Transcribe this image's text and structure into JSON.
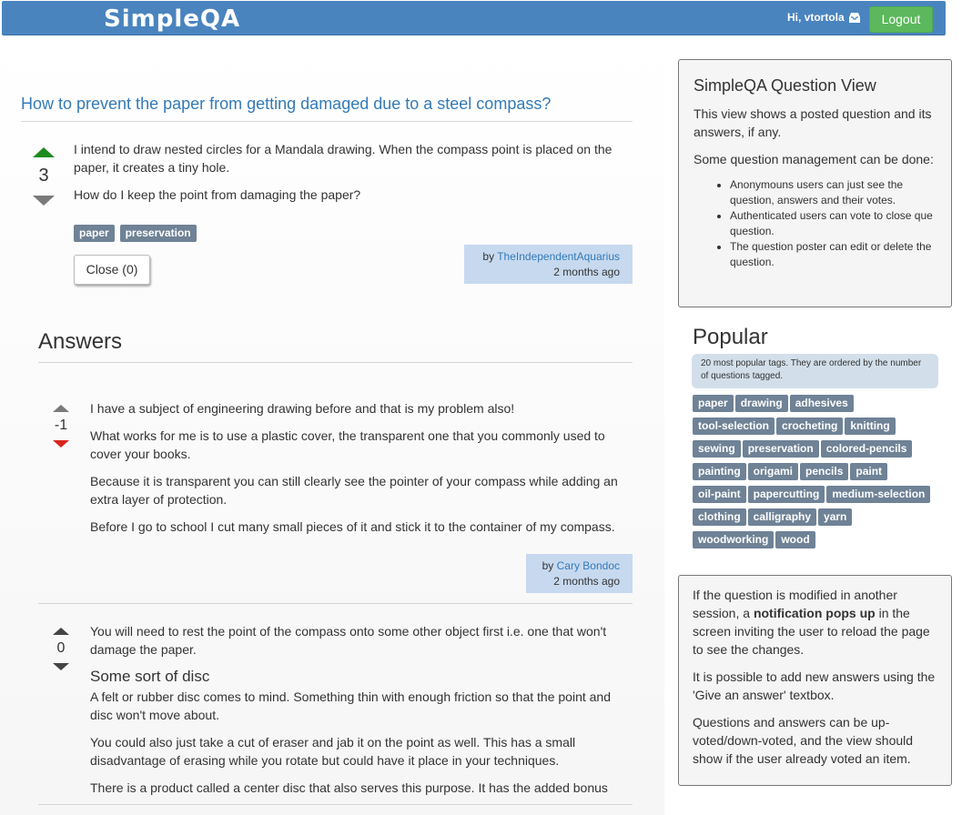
{
  "navbar": {
    "brand_part1": "Simple",
    "brand_part2": "QA",
    "greeting": "Hi, vtortola",
    "logout_label": "Logout"
  },
  "question": {
    "title": "How to prevent the paper from getting damaged due to a steel compass?",
    "votes": "3",
    "paragraphs": [
      "I intend to draw nested circles for a Mandala drawing. When the compass point is placed on the paper, it creates a tiny hole.",
      "How do I keep the point from damaging the paper?"
    ],
    "tags": [
      "paper",
      "preservation"
    ],
    "close_label": "Close (0)",
    "by_label": "by",
    "author": "TheIndependentAquarius",
    "time": "2 months ago"
  },
  "answers_heading": "Answers",
  "answers": [
    {
      "votes": "-1",
      "paragraphs": [
        "I have a subject of engineering drawing before and that is my problem also!",
        "What works for me is to use a plastic cover, the transparent one that you commonly used to cover your books.",
        "Because it is transparent you can still clearly see the pointer of your compass while adding an extra layer of protection.",
        "Before I go to school I cut many small pieces of it and stick it to the container of my compass."
      ],
      "by_label": "by",
      "author": "Cary Bondoc",
      "time": "2 months ago"
    },
    {
      "votes": "0",
      "intro": "You will need to rest the point of the compass onto some other object first i.e. one that won't damage the paper.",
      "subheading": "Some sort of disc",
      "paragraphs": [
        "A felt or rubber disc comes to mind. Something thin with enough friction so that the point and disc won't move about.",
        "You could also just take a cut of eraser and jab it on the point as well. This has a small disadvantage of erasing while you rotate but could have it place in your techniques.",
        "There is a product called a center disc that also serves this purpose. It has the added bonus"
      ]
    }
  ],
  "sidebar": {
    "view_panel": {
      "title": "SimpleQA Question View",
      "p1": "This view shows a posted question and its answers, if any.",
      "p2": "Some question management can be done:",
      "items": [
        "Anonymouns users can just see the question, answers and their votes.",
        "Authenticated users can vote to close que question.",
        "The question poster can edit or delete the question."
      ]
    },
    "popular": {
      "title": "Popular",
      "note": "20 most popular tags. They are ordered by the number of questions tagged.",
      "tags": [
        "paper",
        "drawing",
        "adhesives",
        "tool-selection",
        "crocheting",
        "knitting",
        "sewing",
        "preservation",
        "colored-pencils",
        "painting",
        "origami",
        "pencils",
        "paint",
        "oil-paint",
        "papercutting",
        "medium-selection",
        "clothing",
        "calligraphy",
        "yarn",
        "woodworking",
        "wood"
      ]
    },
    "info_panel": {
      "p1_before": "If the question is modified in another session, a ",
      "p1_bold": "notification pops up",
      "p1_after": " in the screen inviting the user to reload the page to see the changes.",
      "p2": "It is possible to add new answers using the 'Give an answer' textbox.",
      "p3": "Questions and answers can be up-voted/down-voted, and the view should show if the user already voted an item."
    }
  },
  "colors": {
    "navbar": "#4a84bf",
    "logout": "#5cb85c",
    "link": "#337ab7",
    "tag": "#6f8296",
    "upvote_active": "#1d8a1d",
    "downvote_active": "#d9251c"
  }
}
